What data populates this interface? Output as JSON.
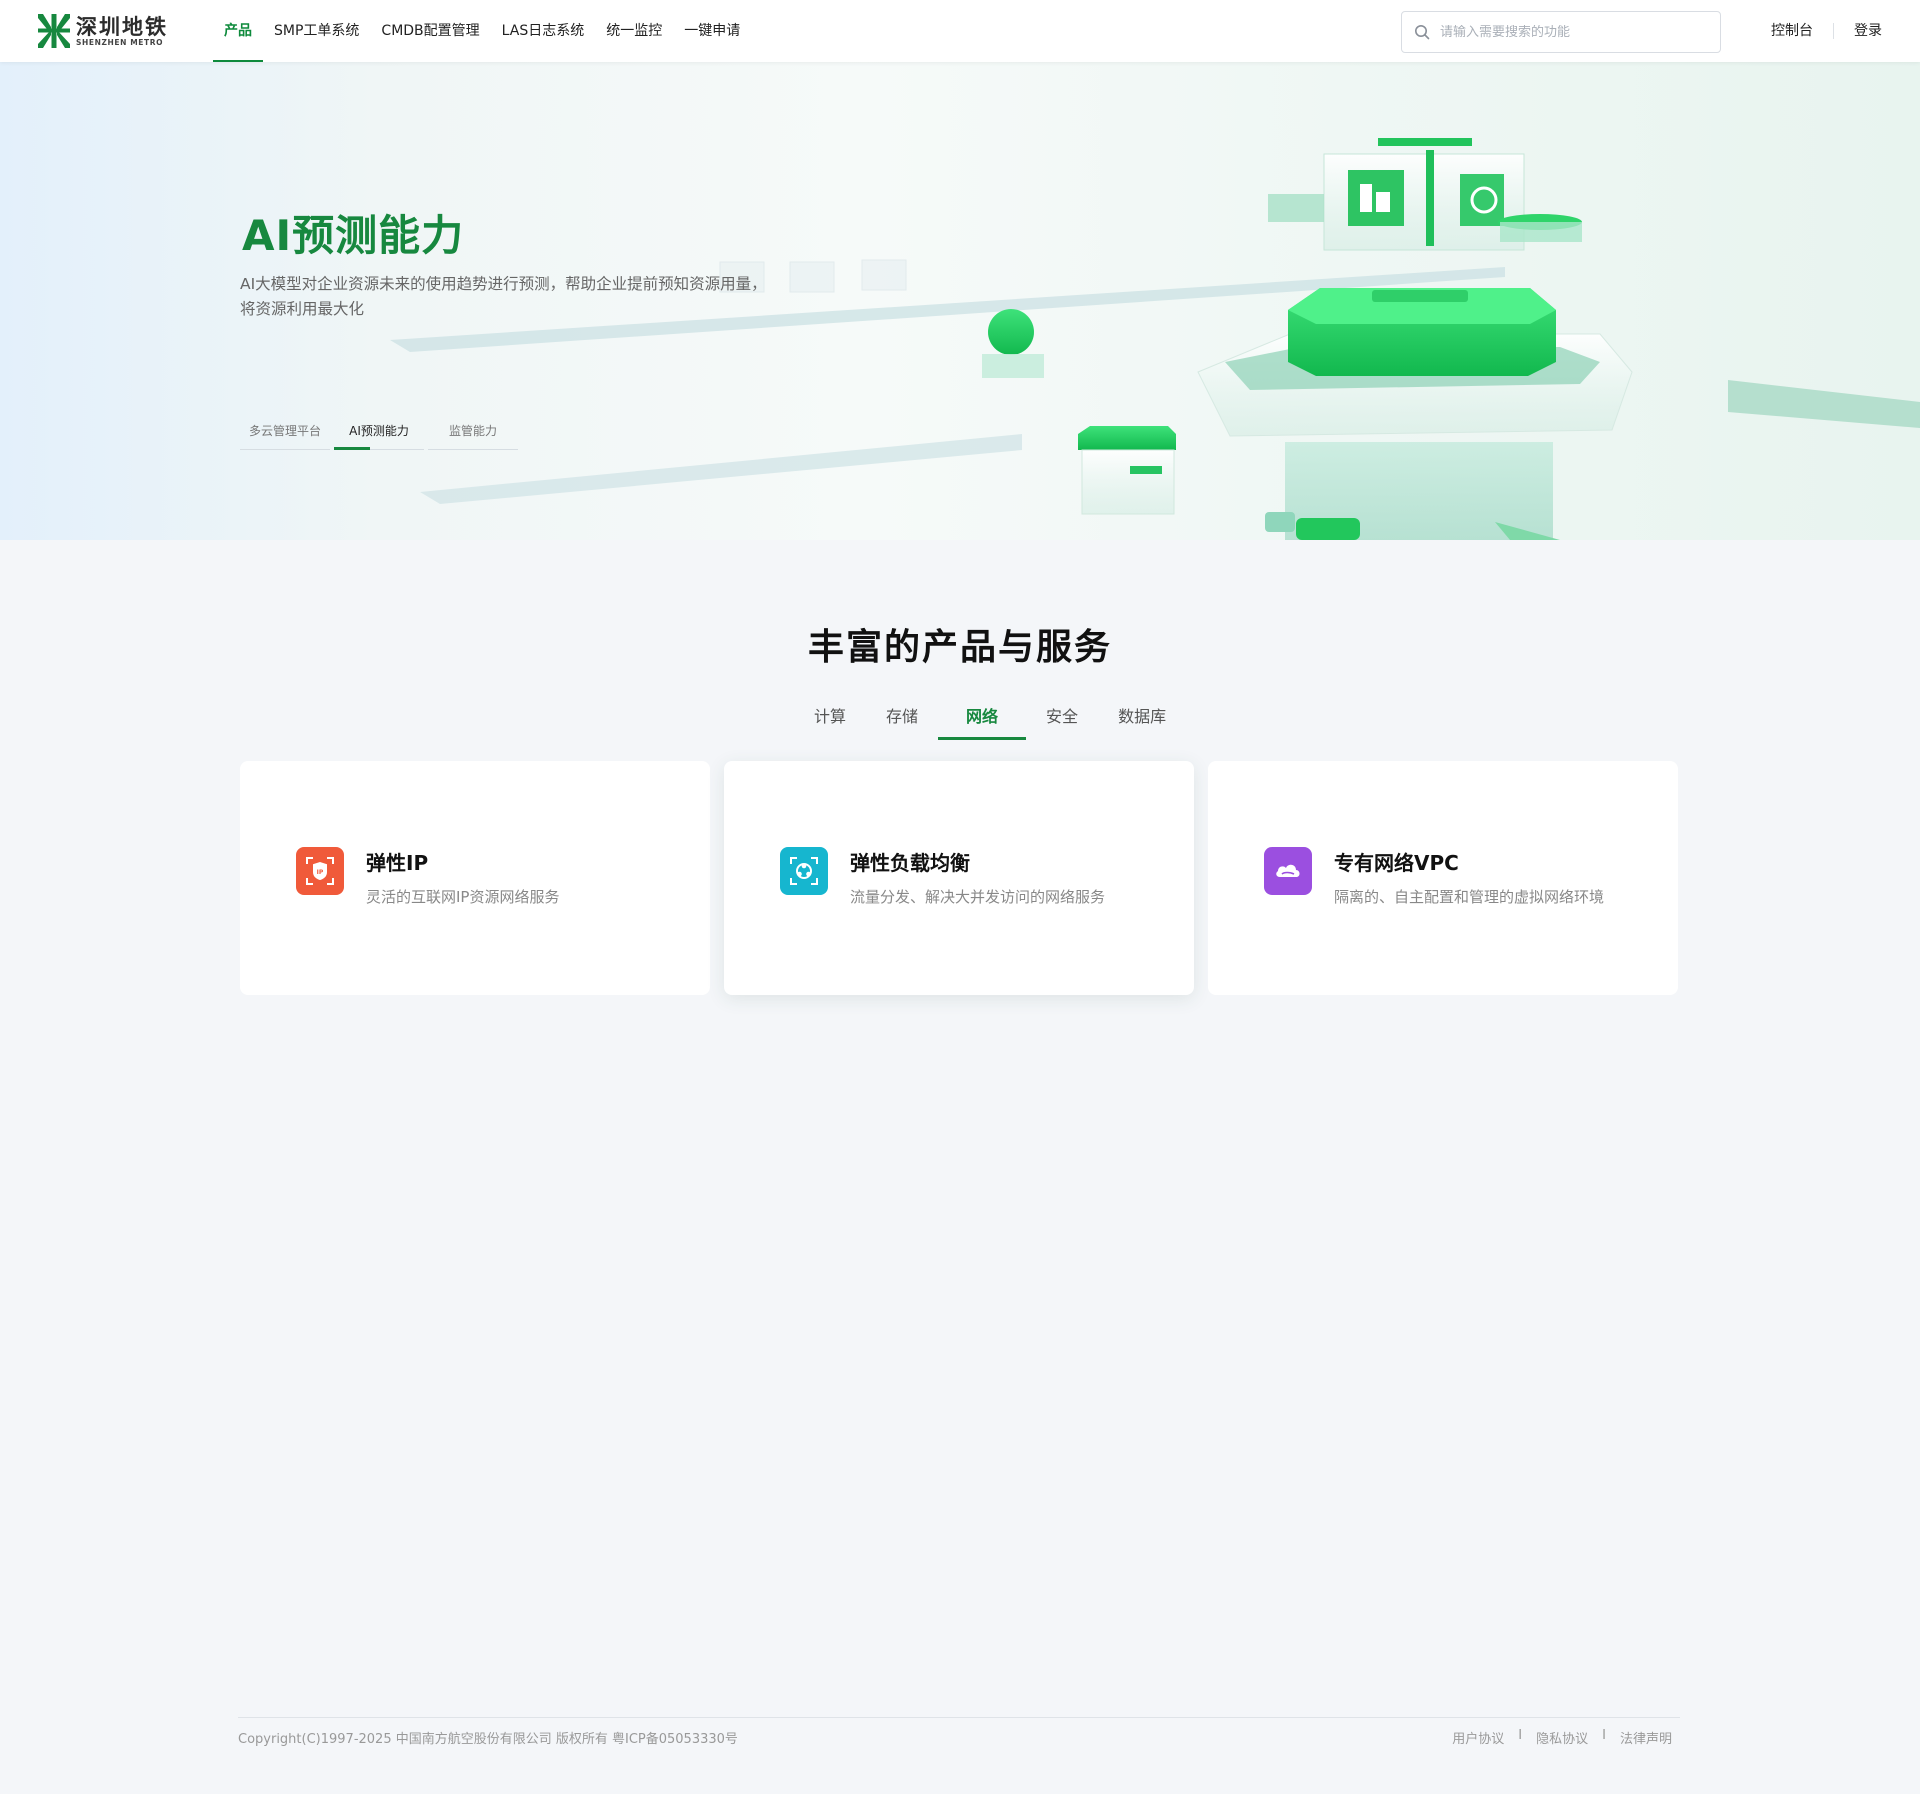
{
  "header": {
    "logo_cn": "深圳地铁",
    "logo_en": "SHENZHEN METRO",
    "nav": [
      {
        "label": "产品",
        "active": true
      },
      {
        "label": "SMP工单系统",
        "active": false
      },
      {
        "label": "CMDB配置管理",
        "active": false
      },
      {
        "label": "LAS日志系统",
        "active": false
      },
      {
        "label": "统一监控",
        "active": false
      },
      {
        "label": "一键申请",
        "active": false
      }
    ],
    "search_placeholder": "请输入需要搜索的功能",
    "console_label": "控制台",
    "login_label": "登录"
  },
  "hero": {
    "title": "AI预测能力",
    "description": "AI大模型对企业资源未来的使用趋势进行预测，帮助企业提前预知资源用量，将资源利用最大化",
    "tabs": [
      {
        "label": "多云管理平台",
        "active": false
      },
      {
        "label": "AI预测能力",
        "active": true
      },
      {
        "label": "监管能力",
        "active": false
      }
    ]
  },
  "section": {
    "title": "丰富的产品与服务",
    "categories": [
      {
        "label": "计算",
        "active": false
      },
      {
        "label": "存储",
        "active": false
      },
      {
        "label": "网络",
        "active": true
      },
      {
        "label": "安全",
        "active": false
      },
      {
        "label": "数据库",
        "active": false
      }
    ],
    "cards": [
      {
        "title": "弹性IP",
        "description": "灵活的互联网IP资源网络服务",
        "icon": "elastic-ip-icon",
        "color": "#f05a3a"
      },
      {
        "title": "弹性负载均衡",
        "description": "流量分发、解决大并发访问的网络服务",
        "icon": "load-balancer-icon",
        "color": "#16b6cf"
      },
      {
        "title": "专有网络VPC",
        "description": "隔离的、自主配置和管理的虚拟网络环境",
        "icon": "vpc-cloud-icon",
        "color": "#9b4fe0"
      }
    ]
  },
  "footer": {
    "copyright": "Copyright(C)1997-2025 中国南方航空股份有限公司 版权所有 粤ICP备05053330号",
    "links": [
      "用户协议",
      "隐私协议",
      "法律声明"
    ],
    "separator": "I"
  },
  "colors": {
    "brand_green": "#17883f",
    "background": "#f4f6f9"
  }
}
